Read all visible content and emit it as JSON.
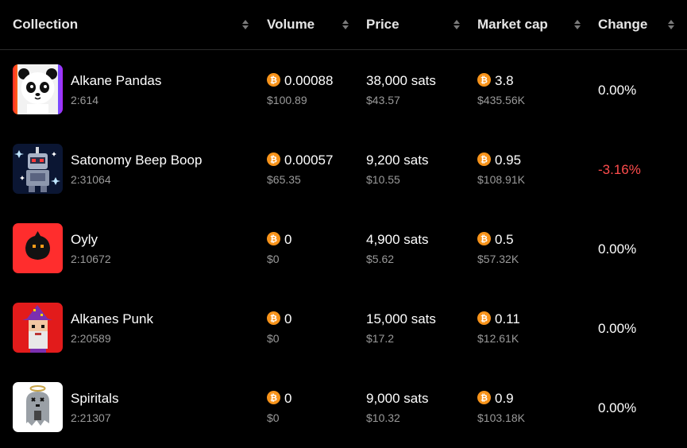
{
  "colors": {
    "background": "#000000",
    "positive_neutral": "#ffffff",
    "negative": "#ff4d4d",
    "muted": "#9a9a9a",
    "coin": "#f7931a"
  },
  "columns": [
    {
      "label": "Collection"
    },
    {
      "label": "Volume"
    },
    {
      "label": "Price"
    },
    {
      "label": "Market cap"
    },
    {
      "label": "Change"
    }
  ],
  "rows": [
    {
      "name": "Alkane Pandas",
      "id": "2:614",
      "volume_btc": "0.00088",
      "volume_usd": "$100.89",
      "price_sats": "38,000 sats",
      "price_usd": "$43.57",
      "mcap_btc": "3.8",
      "mcap_usd": "$435.56K",
      "change": "0.00%",
      "change_dir": "neutral",
      "thumb": "panda-avatar-icon"
    },
    {
      "name": "Satonomy Beep Boop",
      "id": "2:31064",
      "volume_btc": "0.00057",
      "volume_usd": "$65.35",
      "price_sats": "9,200 sats",
      "price_usd": "$10.55",
      "mcap_btc": "0.95",
      "mcap_usd": "$108.91K",
      "change": "-3.16%",
      "change_dir": "negative",
      "thumb": "robot-avatar-icon"
    },
    {
      "name": "Oyly",
      "id": "2:10672",
      "volume_btc": "0",
      "volume_usd": "$0",
      "price_sats": "4,900 sats",
      "price_usd": "$5.62",
      "mcap_btc": "0.5",
      "mcap_usd": "$57.32K",
      "change": "0.00%",
      "change_dir": "neutral",
      "thumb": "blob-avatar-icon"
    },
    {
      "name": "Alkanes Punk",
      "id": "2:20589",
      "volume_btc": "0",
      "volume_usd": "$0",
      "price_sats": "15,000 sats",
      "price_usd": "$17.2",
      "mcap_btc": "0.11",
      "mcap_usd": "$12.61K",
      "change": "0.00%",
      "change_dir": "neutral",
      "thumb": "wizard-avatar-icon"
    },
    {
      "name": "Spiritals",
      "id": "2:21307",
      "volume_btc": "0",
      "volume_usd": "$0",
      "price_sats": "9,000 sats",
      "price_usd": "$10.32",
      "mcap_btc": "0.9",
      "mcap_usd": "$103.18K",
      "change": "0.00%",
      "change_dir": "neutral",
      "thumb": "ghost-avatar-icon"
    }
  ]
}
